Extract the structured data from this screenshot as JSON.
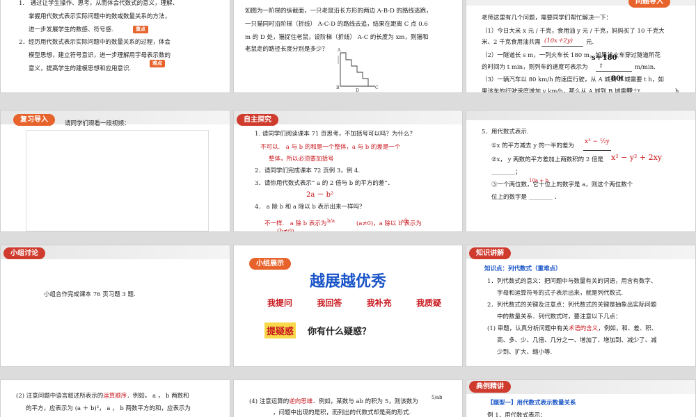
{
  "slide1": {
    "item1": "1.　通过让学生操作、思考，从而体会代数式的意义，理解、",
    "item1b": "掌握用代数式表示实际问题中的数或数量关系的方法，",
    "item1c": "进一步发展学生的数感、符号感.",
    "badge1": "重点",
    "item2": "2．经历用代数式表示实际问题中的数量关系的过程，体会",
    "item2b": "模型思想，建立符号意识，进一步理解用字母表示数的",
    "item2c": "意义，提高学生的建模思想和应用意识.",
    "badge2": "难点"
  },
  "slide2": {
    "line1": "如图为一阶梯的纵截面，一只老鼠沿长方形的两边 A-B-D 的路线逃跑，",
    "line2": "一只猫同时沿阶梯（折线） A-C-D 的路线去追，结果在距离 C 点 0.6",
    "line3": "m 的 D 处，猫捉住老鼠，设阶梯（折线） A-C 的长度为 xm，则猫和",
    "line4": "老鼠走的路径长度分别是多少？",
    "fig_a": "A",
    "fig_b": "B",
    "fig_c": "C",
    "fig_d": "D"
  },
  "slide3": {
    "tag": "问题导入",
    "intro": "老师这里有几个问题，需要同学们帮忙解决一下：",
    "q1a": "（1）今日大米 x 元 / 千克，食用油 y 元 / 千克，妈妈买了 10 千克大",
    "q1b": "米、2 千克食用油共需",
    "q1c": "元.",
    "a1": "(10x＋2y)",
    "q2a": "（2）一隧道长 s m，一列火车长 180 m，如果该火车穿过隧道所花",
    "q2b": "的时间为 t min，则列车的速度可表示为",
    "q2c": "m/min.",
    "a2": "s＋180",
    "a2d": "t",
    "q3a": "（3）一辆汽车以 80 km/h 的速度行驶，从 A 城到 B 城需要 t h，如",
    "q3b": "果该车的行驶速度增加 v km/h，那么从 A 城到 B 城需要",
    "q3c": "h.",
    "a3": "80t",
    "a3d": "80＋v"
  },
  "slide4": {
    "tag": "复习导入",
    "text": "请同学们观看一段视频："
  },
  "slide5": {
    "tag": "自主探究",
    "q1": "1. 请同学们阅读课本 71 页思考，不加括号可以吗？为什么？",
    "a1a": "不可以.　a 与 b 的和是一个整体，a 与 b 的差是一个",
    "a1b": "整体，所以必须要加括号",
    "q2": "2．请同学们完成课本 72 页例 3，例 4.",
    "q3": "3．请你用代数式表示“ a 的 2 倍与 b 的平方的差”．",
    "a3": "2a － b²",
    "q4": "4．  a 除 b 和 a 除以 b 表示出来一样吗？",
    "a4a": "不一样.　a 除 b 表示为",
    "a4f": "b/a",
    "a4b": "(a≠0)，a 除以 b 表示为",
    "a4g": "a/b",
    "a4c": "(b≠0)"
  },
  "slide6": {
    "q5": "5．用代数式表示.",
    "i1": "①x 的平方减去 y 的一半的差为",
    "a1": "x² − ½y",
    "i2": "②x，  y 两数的平方差加上两数积的 2 倍是",
    "a2": "x² − y² + 2xy",
    "i2b": "________；",
    "i3": "③一个两位数，它十位上的数字是 a，则这个两位数个",
    "a3": "10a + b",
    "i3b": "位上的数字是 ________ ．"
  },
  "slide7": {
    "tag": "小组讨论",
    "text": "小组合作完成课本 76 页习题 3 题."
  },
  "slide8": {
    "tag": "小组展示",
    "title": "越展越优秀",
    "items": [
      "我提问",
      "我回答",
      "我补充",
      "我质疑"
    ],
    "label": "提疑惑",
    "question": "你有什么疑惑？"
  },
  "slide9": {
    "tag": "知识讲解",
    "point": "知识点：列代数式（重难点）",
    "p1a": "1．列代数式的意义：把问题中与数量有关的词语，用含有数字、",
    "p1b": "字母和运算符号的式子表示出来，就是列代数式.",
    "p2a": "2．列代数式的关键及注意点：列代数式的关键是抽象出实际问题",
    "p2b": "中的数量关系．列代数式时，要注意以下几点：",
    "p3a": "(1) 审题，认真分析问题中有关",
    "p3em": "术语的含义",
    "p3a2": "，例如，和、差、积、",
    "p3b": "商、多、少、几倍、几分之一、增加了、增加到、减少了、减",
    "p3c": "少到、扩大、缩小等."
  },
  "slide10": {
    "l1a": "(2) 注意问题中语言叙述所表示的",
    "l1em": "运算顺序",
    "l1b": "．例如，  a ，  b 两数和",
    "l2": "的平方，应表示为 (a ＋ b)²，  a ，  b 两数平方的和，应表示为"
  },
  "slide11": {
    "l1a": "(4) 注意运算的",
    "l1em": "逆向思维",
    "l1b": "．例如，某数与 ab 的积为 5，则该数为",
    "frac": "5/ab",
    "l2": "，问题中出现的是积，而列出的代数式却是商的形式."
  },
  "slide12": {
    "tag": "典例精讲",
    "topic": "【题型一】用代数式表示数量关系",
    "ex": "例 1．用代数式表示："
  },
  "colors": {
    "accent": "#e8632b",
    "answer": "#c8161d",
    "blue": "#1a55c8"
  }
}
